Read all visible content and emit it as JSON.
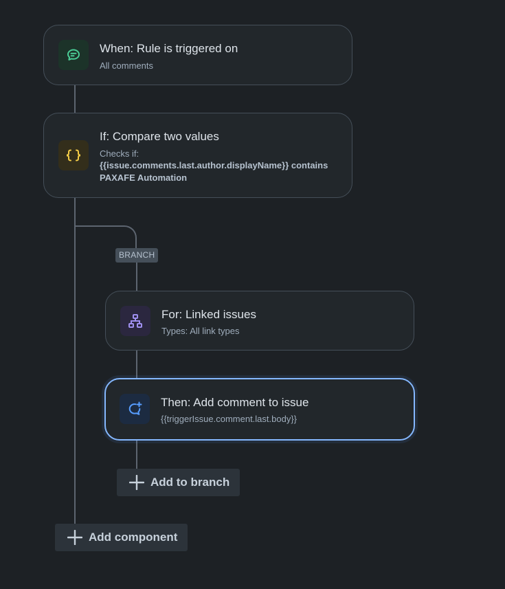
{
  "trigger": {
    "title": "When: Rule is triggered on",
    "subtitle": "All comments",
    "icon": "comment-icon",
    "icon_color": "#4bce97",
    "icon_bg": "#1c3329"
  },
  "condition": {
    "title": "If: Compare two values",
    "subtitle": "Checks if:",
    "detail": "{{issue.comments.last.author.displayName}} contains PAXAFE Automation",
    "icon": "braces-icon",
    "icon_color": "#f5cd47",
    "icon_bg": "#332e1b"
  },
  "branch": {
    "badge": "BRANCH",
    "branch_rule": {
      "title": "For: Linked issues",
      "subtitle": "Types: All link types",
      "icon": "hierarchy-icon",
      "icon_color": "#9f8fef",
      "icon_bg": "#2b273f"
    },
    "action": {
      "title": "Then: Add comment to issue",
      "subtitle": "{{triggerIssue.comment.last.body}}",
      "icon": "add-comment-icon",
      "icon_color": "#579dff",
      "icon_bg": "#1c2b41"
    },
    "add_label": "Add to branch"
  },
  "add_component_label": "Add component",
  "colors": {
    "background": "#1d2125",
    "card": "#22272b",
    "card_border": "#454f59",
    "selected_border": "#85b8ff",
    "connector": "#5d6570"
  }
}
